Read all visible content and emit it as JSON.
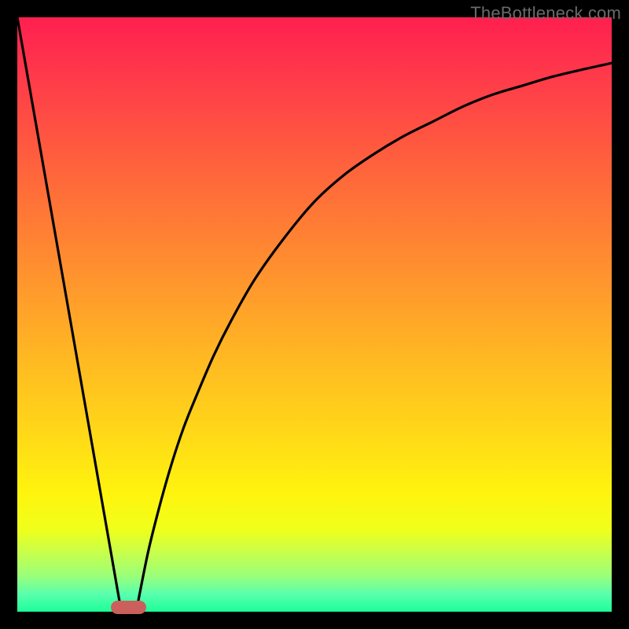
{
  "watermark": "TheBottleneck.com",
  "colors": {
    "background": "#000000",
    "marker": "#cb5f5c",
    "curve": "#000000",
    "gradient_top": "#ff1f4f",
    "gradient_bottom": "#1cff9a"
  },
  "chart_data": {
    "type": "line",
    "title": "",
    "xlabel": "",
    "ylabel": "",
    "xlim": [
      0,
      100
    ],
    "ylim": [
      0,
      100
    ],
    "series": [
      {
        "name": "left-line",
        "x": [
          0,
          17.5
        ],
        "y": [
          100,
          0
        ]
      },
      {
        "name": "right-curve",
        "x": [
          20,
          22,
          24,
          26,
          28,
          30,
          33,
          36,
          40,
          45,
          50,
          55,
          60,
          65,
          70,
          75,
          80,
          85,
          90,
          95,
          100
        ],
        "y": [
          0,
          10,
          18,
          25,
          31,
          36,
          43,
          49,
          56,
          63,
          69,
          73.5,
          77,
          80,
          82.5,
          85,
          87,
          88.5,
          90,
          91.2,
          92.3
        ]
      }
    ],
    "marker": {
      "x_center": 18.7,
      "width_pct": 6.0,
      "y": 0
    },
    "grid": false,
    "legend": false
  }
}
